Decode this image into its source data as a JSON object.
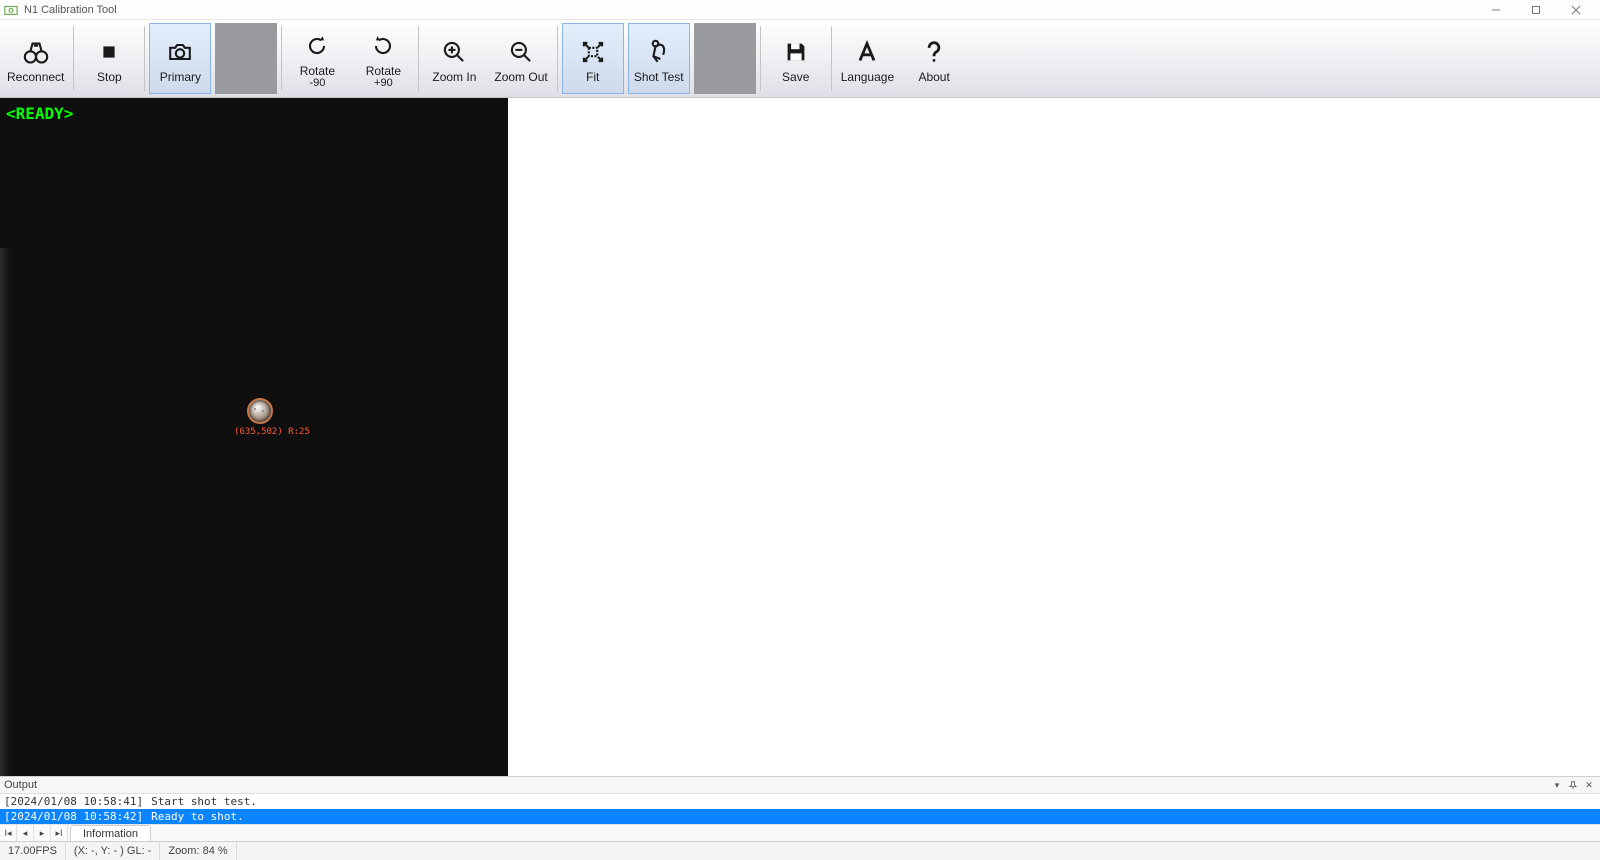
{
  "window": {
    "title": "N1 Calibration Tool"
  },
  "toolbar": {
    "reconnect": "Reconnect",
    "stop": "Stop",
    "primary": "Primary",
    "rotate_neg": "Rotate",
    "rotate_neg_sub": "-90",
    "rotate_pos": "Rotate",
    "rotate_pos_sub": "+90",
    "zoom_in": "Zoom In",
    "zoom_out": "Zoom Out",
    "fit": "Fit",
    "shot_test": "Shot Test",
    "save": "Save",
    "language": "Language",
    "about": "About"
  },
  "camera": {
    "ready_label": "<READY>",
    "ball_annotation": "(635,502) R:25"
  },
  "output": {
    "title": "Output",
    "tab_label": "Information",
    "logs": [
      {
        "ts": "[2024/01/08 10:58:41]",
        "msg": "Start shot test."
      },
      {
        "ts": "[2024/01/08 10:58:42]",
        "msg": "Ready to shot."
      }
    ],
    "selected_index": 1
  },
  "status": {
    "fps": "17.00FPS",
    "coord": "(X: -, Y: - ) GL: -",
    "zoom": "Zoom: 84 %"
  }
}
